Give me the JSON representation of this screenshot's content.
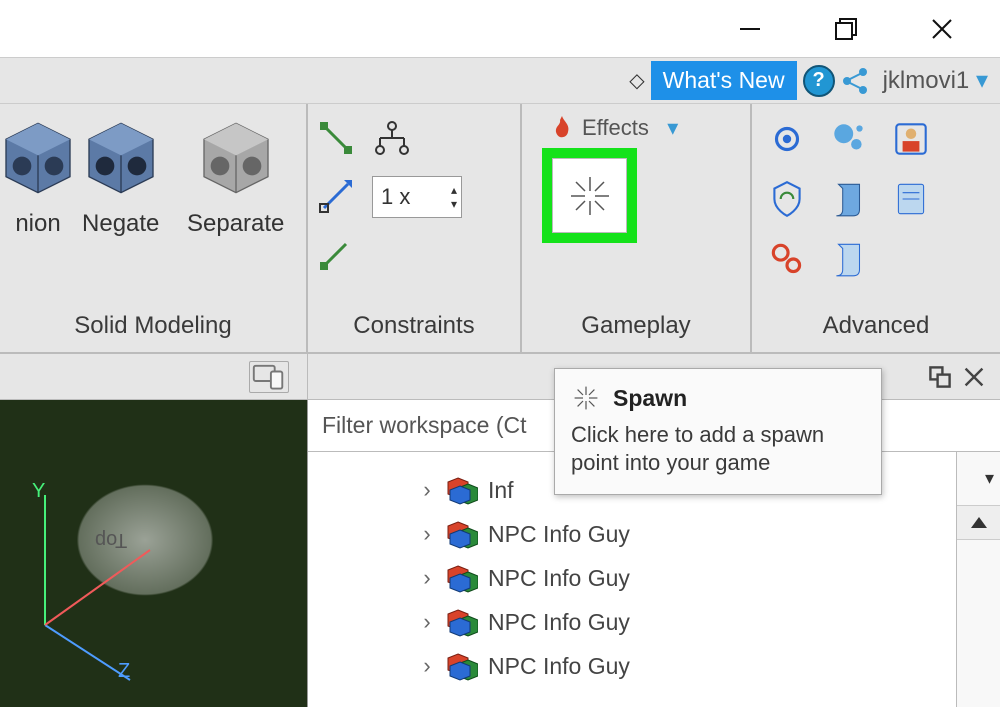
{
  "window_controls": {
    "minimize": "—",
    "restore": "❐",
    "close": "✕"
  },
  "topbar": {
    "whats_new": "What's New",
    "username": "jklmovi1"
  },
  "ribbon": {
    "solid_modeling": {
      "label": "Solid Modeling",
      "buttons": {
        "union": "nion",
        "negate": "Negate",
        "separate": "Separate"
      }
    },
    "constraints": {
      "label": "Constraints",
      "multiplier": "1 x"
    },
    "gameplay": {
      "label": "Gameplay",
      "effects_label": "Effects"
    },
    "advanced": {
      "label": "Advanced"
    }
  },
  "viewport": {
    "axis_y": "Y",
    "axis_z": "Z",
    "part_label": "Top"
  },
  "explorer": {
    "filter_placeholder": "Filter workspace (Ct",
    "items": [
      {
        "label": "Inf"
      },
      {
        "label": "NPC Info Guy"
      },
      {
        "label": "NPC Info Guy"
      },
      {
        "label": "NPC Info Guy"
      },
      {
        "label": "NPC Info Guy"
      }
    ]
  },
  "tooltip": {
    "title": "Spawn",
    "body": "Click here to add a spawn point into your game"
  }
}
